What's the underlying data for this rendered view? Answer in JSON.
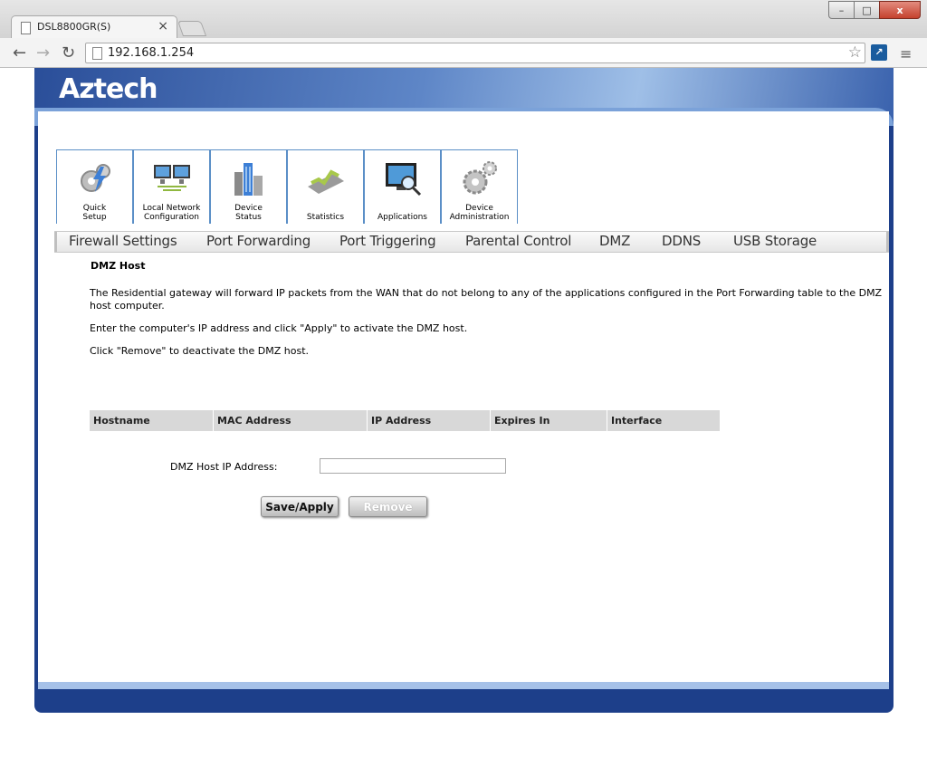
{
  "browser": {
    "tab_title": "DSL8800GR(S)",
    "tab_close": "×",
    "url": "192.168.1.254",
    "window_min": "–",
    "window_max": "□",
    "window_close": "x"
  },
  "header": {
    "brand": "Aztech"
  },
  "main_nav": [
    {
      "label": "Quick\nSetup",
      "icon": "gears-lightning-icon"
    },
    {
      "label": "Local  Network\nConfiguration",
      "icon": "monitors-icon"
    },
    {
      "label": "Device\nStatus",
      "icon": "buildings-icon"
    },
    {
      "label": "Statistics",
      "icon": "chart-icon"
    },
    {
      "label": "Applications",
      "icon": "monitor-magnifier-icon"
    },
    {
      "label": "Device\nAdministration",
      "icon": "gears-icon"
    }
  ],
  "sub_nav": [
    "Firewall Settings",
    "Port Forwarding",
    "Port Triggering",
    "Parental Control",
    "DMZ",
    "DDNS",
    "USB Storage"
  ],
  "page": {
    "title": "DMZ Host",
    "desc1": "The Residential gateway will forward IP packets from the WAN that do not belong to any of the applications configured in the Port Forwarding table to the DMZ host computer.",
    "desc2": "Enter the computer's IP address and click \"Apply\" to activate the DMZ host.",
    "desc3": "Click \"Remove\" to deactivate the DMZ host.",
    "table_headers": [
      "Hostname",
      "MAC Address",
      "IP Address",
      "Expires In",
      "Interface"
    ],
    "ip_label": "DMZ Host IP Address:",
    "ip_value": "",
    "save_label": "Save/Apply",
    "remove_label": "Remove"
  },
  "colors": {
    "frame": "#1d3f8a",
    "tab_border": "#5b8fc7",
    "table_header": "#d8d8d8"
  }
}
